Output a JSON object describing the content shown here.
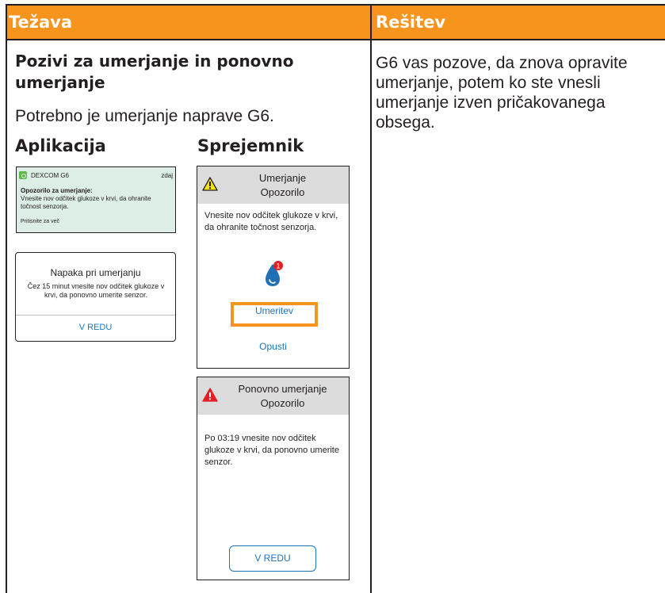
{
  "table": {
    "problem_header": "Težava",
    "solution_header": "Rešitev"
  },
  "issue": {
    "title": "Pozivi za umerjanje in ponovno umerjanje",
    "description": "Potrebno je umerjanje naprave G6.",
    "app_heading": "Aplikacija",
    "receiver_heading": "Sprejemnik"
  },
  "notification": {
    "app_name": "DEXCOM G6",
    "time": "zdaj",
    "title": "Opozorilo za umerjanje:",
    "body": "Vnesite nov odčitek glukoze v krvi, da ohranite točnost senzorja.",
    "more": "Pritisnite za več"
  },
  "app_dialog": {
    "title": "Napaka pri umerjanju",
    "message": "Čez 15 minut vnesite nov odčitek glukoze v krvi, da ponovno umerite senzor.",
    "button": "V REDU"
  },
  "receiver_calibration": {
    "title_line1": "Umerjanje",
    "title_line2": "Opozorilo",
    "message": "Vnesite nov odčitek glukoze v krvi, da ohranite točnost senzorja.",
    "badge": "1",
    "primary_button": "Umeritev",
    "secondary_button": "Opusti",
    "icon": "warning-triangle-yellow-icon"
  },
  "receiver_recalibration": {
    "title_line1": "Ponovno umerjanje",
    "title_line2": "Opozorilo",
    "message": "Po 03:19 vnesite nov odčitek glukoze v krvi, da ponovno umerite senzor.",
    "button": "V REDU",
    "icon": "warning-triangle-red-icon"
  },
  "solution": {
    "text": "G6 vas pozove, da znova opravite umerjanje, potem ko ste vnesli umerjanje izven pričakovanega obsega."
  },
  "colors": {
    "header_orange": "#f7941d",
    "notification_bg": "#ddeee6",
    "link_blue": "#1c75bc",
    "receiver_header_gray": "#dcdcdc",
    "warning_yellow": "#f5e11e",
    "warning_red": "#e31e24",
    "drop_blue": "#1f6fb5"
  }
}
